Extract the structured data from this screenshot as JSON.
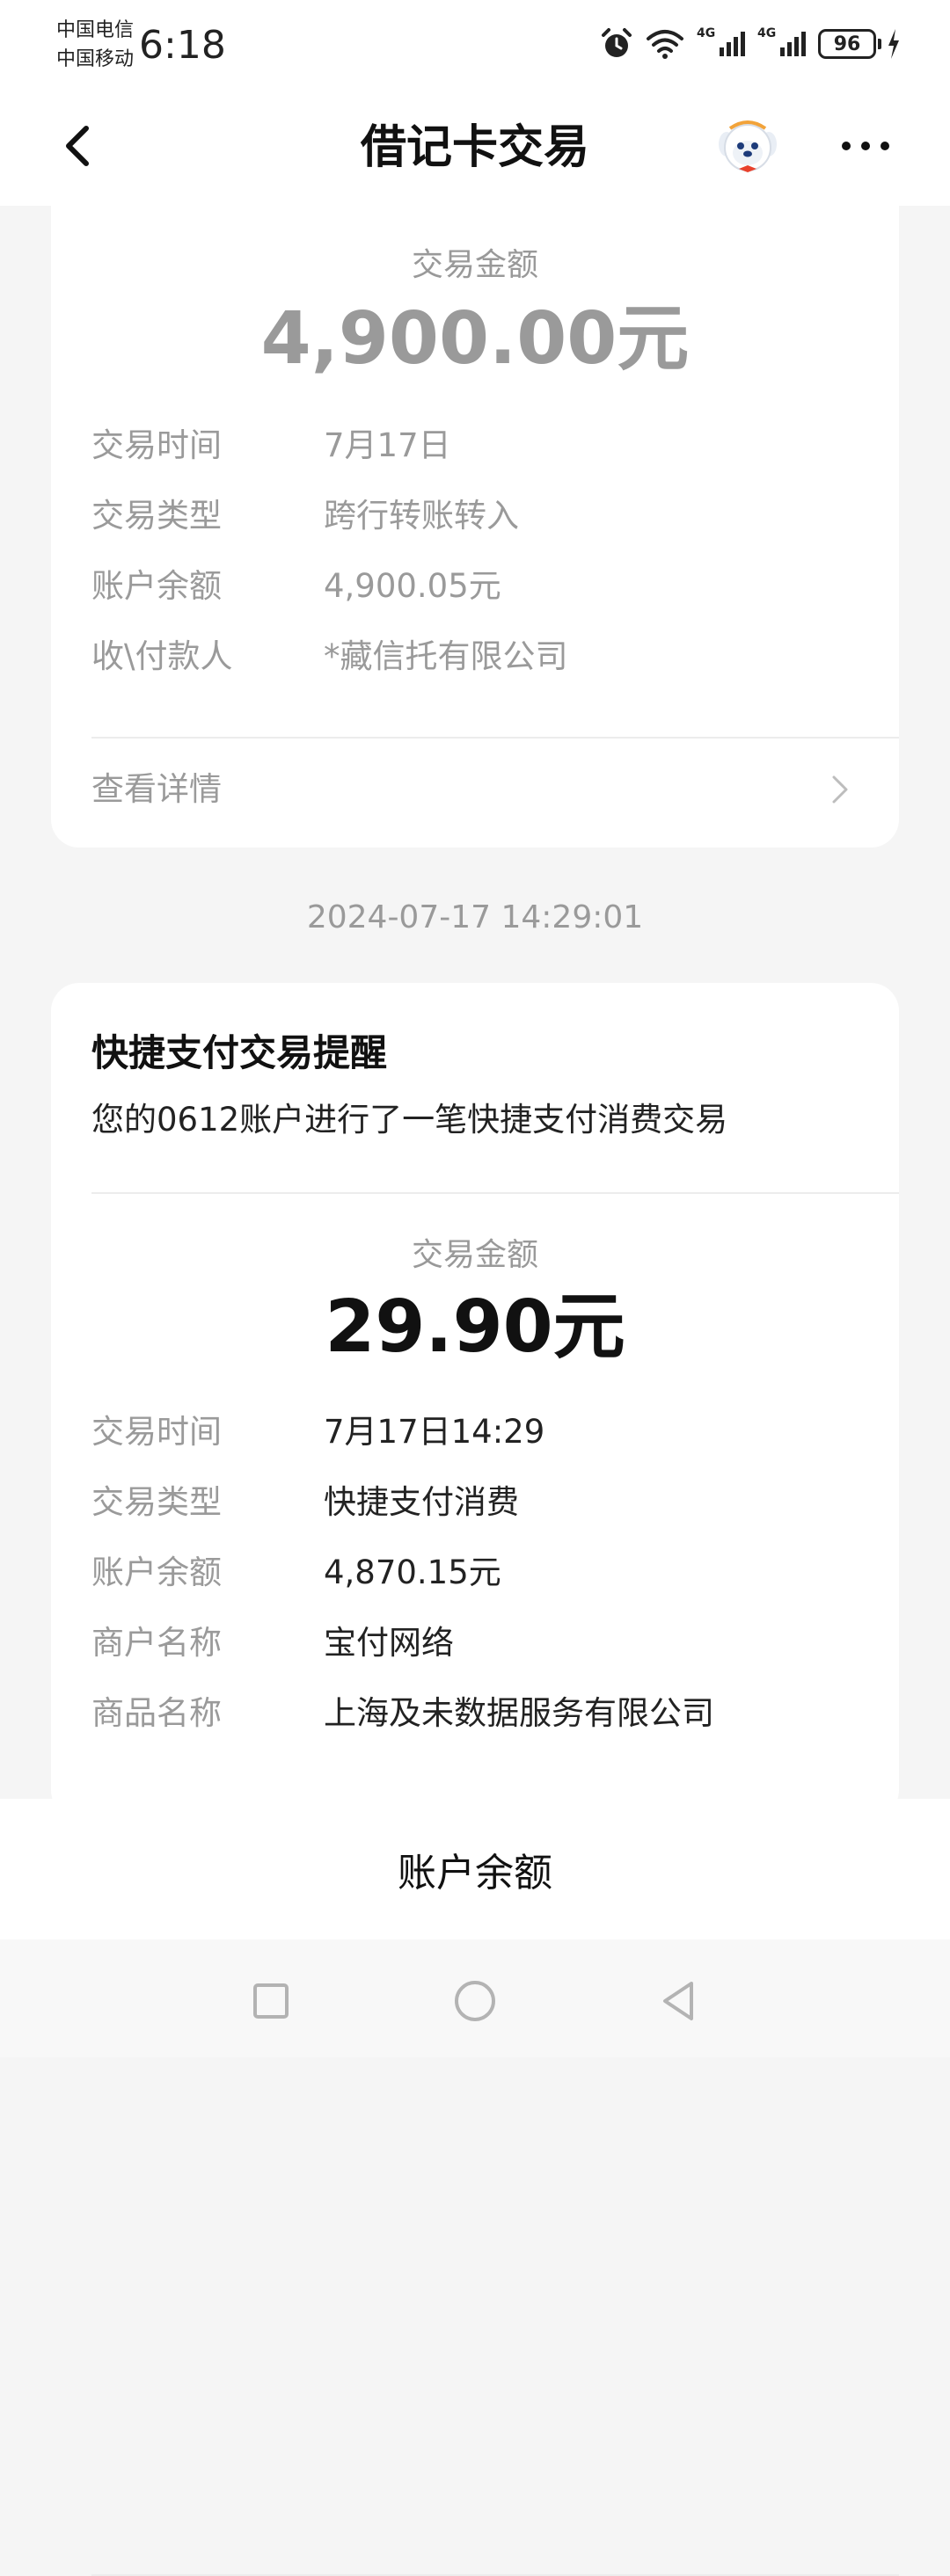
{
  "status_bar": {
    "carrier_1": "中国电信",
    "carrier_2": "中国移动",
    "time": "6:18",
    "signal_1_label": "4G",
    "signal_2_label": "4G",
    "battery": "96"
  },
  "nav": {
    "title": "借记卡交易"
  },
  "card1": {
    "amount_label": "交易金额",
    "amount": "4,900.00元",
    "rows": [
      {
        "key": "交易时间",
        "value": "7月17日"
      },
      {
        "key": "交易类型",
        "value": "跨行转账转入"
      },
      {
        "key": "账户余额",
        "value": "4,900.05元"
      },
      {
        "key": "收\\付款人",
        "value": "*藏信托有限公司"
      }
    ],
    "detail_label": "查看详情"
  },
  "timestamp": "2024-07-17 14:29:01",
  "card2": {
    "title": "快捷支付交易提醒",
    "description": "您的0612账户进行了一笔快捷支付消费交易",
    "amount_label": "交易金额",
    "amount": "29.90元",
    "rows": [
      {
        "key": "交易时间",
        "value": "7月17日14:29"
      },
      {
        "key": "交易类型",
        "value": "快捷支付消费"
      },
      {
        "key": "账户余额",
        "value": "4,870.15元"
      },
      {
        "key": "商户名称",
        "value": "宝付网络"
      },
      {
        "key": "商品名称",
        "value": "上海及未数据服务有限公司"
      }
    ]
  },
  "bottom_action": {
    "label": "账户余额"
  },
  "icons": {
    "back": "back-arrow-icon",
    "mascot": "assistant-mascot-icon",
    "more": "more-dots-icon",
    "chevron": "chevron-right-icon",
    "alarm": "alarm-icon",
    "wifi": "wifi-icon",
    "recent": "square-icon",
    "home": "circle-icon",
    "back_nav": "triangle-back-icon"
  },
  "colors": {
    "muted_text": "#9a9a9a",
    "strong_text": "#111111",
    "background": "#f5f5f5"
  }
}
